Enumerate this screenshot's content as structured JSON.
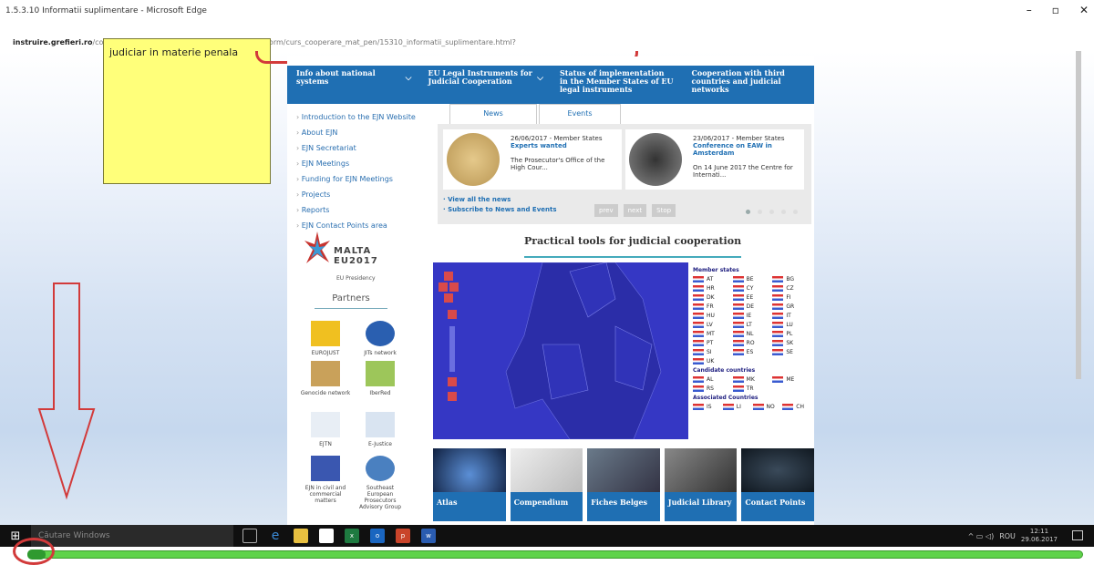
{
  "window": {
    "title": "1.5.3.10 Informatii suplimentare - Microsoft Edge"
  },
  "address": {
    "domain": "instruire.grefieri.ro",
    "path": "/courses/CURSCOOPERAREINMATERIEPENALA/scorm/curs_cooperare_mat_pen/15310_informatii_suplimentare.html?"
  },
  "note": {
    "text": "judiciar in materie penala"
  },
  "site": {
    "nav": [
      "Info about national systems",
      "EU Legal Instruments for Judicial Cooperation",
      "Status of implementation in the Member States of EU legal instruments",
      "Cooperation with third countries and judicial networks"
    ],
    "leftnav": [
      "Introduction to the EJN Website",
      "About EJN",
      "EJN Secretariat",
      "EJN Meetings",
      "Funding for EJN Meetings",
      "Projects",
      "Reports",
      "EJN Contact Points area"
    ],
    "malta": "MALTA EU2017",
    "eu_presidency": "EU Presidency",
    "partners_title": "Partners",
    "partners": [
      "EUROJUST",
      "JITs network",
      "Genocide network",
      "IberRed",
      "EJTN",
      "E-Justice",
      "EJN in civil and commercial matters",
      "Southeast European Prosecutors Advisory Group"
    ],
    "tabs": [
      "News",
      "Events"
    ],
    "news": [
      {
        "date": "26/06/2017 - Member States",
        "title": "Experts wanted",
        "body": "The Prosecutor's Office of the High Cour..."
      },
      {
        "date": "23/06/2017 - Member States",
        "title": "Conference on EAW in Amsterdam",
        "body": "On 14 June 2017 the Centre for Internati..."
      }
    ],
    "news_links": [
      "View all the news",
      "Subscribe to News and Events"
    ],
    "pager": [
      "prev",
      "next",
      "Stop"
    ],
    "practical_title": "Practical tools for judicial cooperation",
    "legend": {
      "member_title": "Member states",
      "members": [
        "AT",
        "BE",
        "BG",
        "HR",
        "CY",
        "CZ",
        "DK",
        "EE",
        "FI",
        "FR",
        "DE",
        "GR",
        "HU",
        "IE",
        "IT",
        "LV",
        "LT",
        "LU",
        "MT",
        "NL",
        "PL",
        "PT",
        "RO",
        "SK",
        "SI",
        "ES",
        "SE",
        "UK"
      ],
      "candidate_title": "Candidate countries",
      "candidates": [
        "AL",
        "MK",
        "ME",
        "RS",
        "TR"
      ],
      "associated_title": "Associated Countries",
      "associated": [
        "IS",
        "LI",
        "NO",
        "CH"
      ]
    },
    "tiles": [
      "Atlas",
      "Compendium",
      "Fiches Belges",
      "Judicial Library",
      "Contact Points"
    ]
  },
  "taskbar": {
    "search_placeholder": "Căutare Windows",
    "lang": "ROU",
    "time": "12:11",
    "date": "29.06.2017"
  },
  "colors": {
    "accent": "#1f6fb3",
    "map": "#3537c4",
    "progress": "#5fd34a",
    "annotation": "#d23a3a"
  },
  "progress": {
    "value": 1.0
  }
}
